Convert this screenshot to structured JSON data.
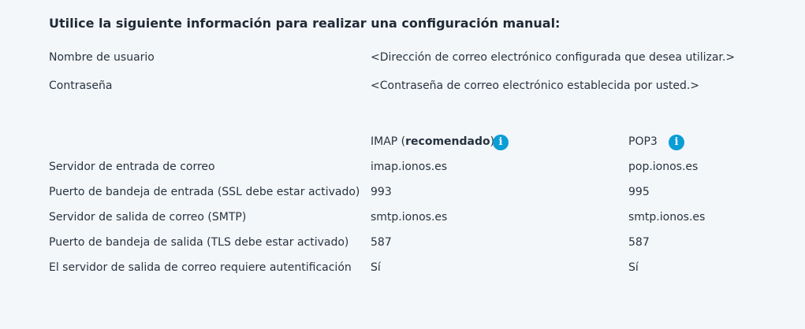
{
  "title": "Utilice la siguiente información para realizar una configuración manual:",
  "credentials": [
    {
      "label": "Nombre de usuario",
      "value": "<Dirección de correo electrónico configurada que desea utilizar.>"
    },
    {
      "label": "Contraseña",
      "value": "<Contraseña de correo electrónico establecida por usted.>"
    }
  ],
  "columns": {
    "imap": {
      "name": "IMAP (",
      "bold": "recomendado",
      "close": ")",
      "icon": "info-icon"
    },
    "pop3": {
      "name": "POP3",
      "icon": "info-icon"
    }
  },
  "settings": [
    {
      "label": "Servidor de entrada de correo",
      "imap": "imap.ionos.es",
      "pop3": "pop.ionos.es"
    },
    {
      "label": "Puerto de bandeja de entrada (SSL debe estar activado)",
      "imap": "993",
      "pop3": "995"
    },
    {
      "label": "Servidor de salida de correo (SMTP)",
      "imap": "smtp.ionos.es",
      "pop3": "smtp.ionos.es"
    },
    {
      "label": "Puerto de bandeja de salida (TLS debe estar activado)",
      "imap": "587",
      "pop3": "587"
    },
    {
      "label": "El servidor de salida de correo requiere autentificación",
      "imap": "Sí",
      "pop3": "Sí"
    }
  ]
}
